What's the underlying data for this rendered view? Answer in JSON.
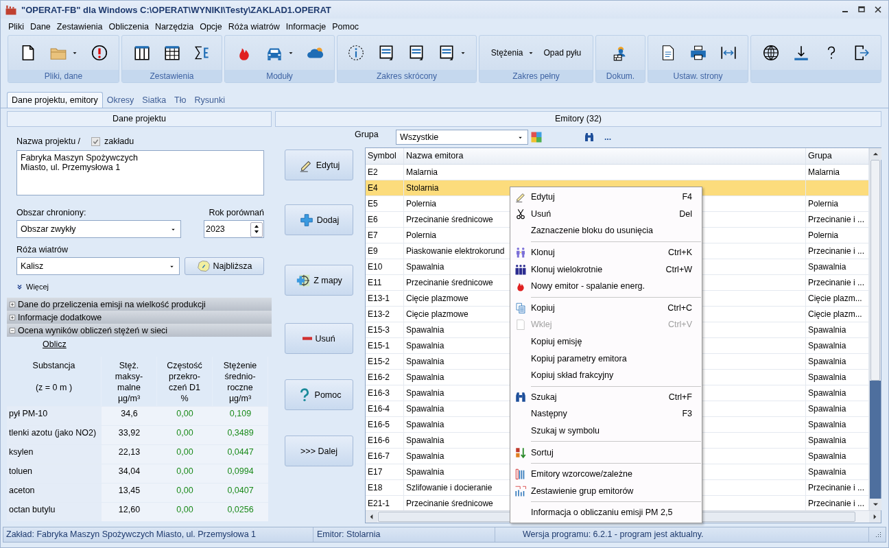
{
  "window": {
    "title": "\"OPERAT-FB\" dla Windows  C:\\OPERAT\\WYNIKI\\Testy\\ZAKLAD1.OPERAT"
  },
  "menu": [
    "Pliki",
    "Dane",
    "Zestawienia",
    "Obliczenia",
    "Narzędzia",
    "Opcje",
    "Róża wiatrów",
    "Informacje",
    "Pomoc"
  ],
  "ribbon": [
    {
      "label": "Pliki, dane",
      "buttons": [
        {
          "kind": "icon",
          "dropdown": false
        },
        {
          "kind": "icon",
          "dropdown": true
        },
        {
          "kind": "icon",
          "dropdown": false
        }
      ]
    },
    {
      "label": "Zestawienia",
      "buttons": [
        {
          "kind": "icon",
          "dropdown": false
        },
        {
          "kind": "icon",
          "dropdown": false
        },
        {
          "kind": "icon",
          "dropdown": false
        }
      ]
    },
    {
      "label": "Moduły",
      "buttons": [
        {
          "kind": "icon",
          "dropdown": false
        },
        {
          "kind": "icon",
          "dropdown": true
        },
        {
          "kind": "icon",
          "dropdown": false
        }
      ]
    },
    {
      "label": "Zakres skrócony",
      "buttons": [
        {
          "kind": "icon",
          "dropdown": false
        },
        {
          "kind": "icon",
          "dropdown": false
        },
        {
          "kind": "icon",
          "dropdown": false
        },
        {
          "kind": "icon",
          "dropdown": true
        }
      ]
    },
    {
      "label": "Zakres pełny",
      "buttons": [
        {
          "kind": "text",
          "label": "Stężenia",
          "dropdown": true
        },
        {
          "kind": "text",
          "label": "Opad pyłu",
          "dropdown": false
        }
      ]
    },
    {
      "label": "Dokum.",
      "buttons": [
        {
          "kind": "icon",
          "dropdown": false
        }
      ]
    },
    {
      "label": "Ustaw. strony",
      "buttons": [
        {
          "kind": "icon",
          "dropdown": false
        },
        {
          "kind": "icon",
          "dropdown": false
        },
        {
          "kind": "icon",
          "dropdown": false
        }
      ]
    },
    {
      "buttons": [
        {
          "kind": "icon",
          "dropdown": false
        },
        {
          "kind": "icon",
          "dropdown": false
        },
        {
          "kind": "icon",
          "dropdown": false
        },
        {
          "kind": "icon",
          "dropdown": false
        }
      ]
    }
  ],
  "tabs": [
    {
      "label": "Dane projektu, emitory",
      "selected": true
    },
    {
      "label": "Okresy",
      "selected": false
    },
    {
      "label": "Siatka",
      "selected": false
    },
    {
      "label": "Tło",
      "selected": false
    },
    {
      "label": "Rysunki",
      "selected": false
    }
  ],
  "project": {
    "title": "Dane projektu",
    "name_label": "Nazwa projektu /",
    "checkbox": {
      "label": "zakładu",
      "checked": true
    },
    "name_value": "Fabryka Maszyn Spożywczych\nMiasto, ul. Przemysłowa 1",
    "area_label": "Obszar chroniony:",
    "area_value": "Obszar zwykły",
    "year_label": "Rok porównań",
    "year_value": "2023",
    "rose_label": "Róża wiatrów",
    "rose_value": "Kalisz",
    "nearest_button": "Najbliższa",
    "more": "Więcej"
  },
  "sections": [
    {
      "label": "Dane do przeliczenia emisji na wielkość produkcji",
      "expanded": false
    },
    {
      "label": "Informacje dodatkowe",
      "expanded": false
    },
    {
      "label": "Ocena wyników obliczeń stężeń w sieci",
      "expanded": true
    }
  ],
  "results": {
    "link": "Oblicz",
    "columns": [
      "Substancja\n\n(z = 0 m )",
      "Stęż.\nmaksy-\nmalne\nµg/m³",
      "Częstość\nprzekro-\nczeń D1\n%",
      "Stężenie\nśrednio-\nroczne\nµg/m³"
    ],
    "rows": [
      {
        "substance": "pył PM-10",
        "max": "34,6",
        "freq": "0,00",
        "avg": "0,109"
      },
      {
        "substance": "tlenki azotu (jako NO2)",
        "max": "33,92",
        "freq": "0,00",
        "avg": "0,3489"
      },
      {
        "substance": "ksylen",
        "max": "22,13",
        "freq": "0,00",
        "avg": "0,0447"
      },
      {
        "substance": "toluen",
        "max": "34,04",
        "freq": "0,00",
        "avg": "0,0994"
      },
      {
        "substance": "aceton",
        "max": "13,45",
        "freq": "0,00",
        "avg": "0,0407"
      },
      {
        "substance": "octan butylu",
        "max": "12,60",
        "freq": "0,00",
        "avg": "0,0256"
      }
    ]
  },
  "actions": [
    "Edytuj",
    "Dodaj",
    "Z mapy",
    "Usuń",
    "Pomoc",
    ">>> Dalej"
  ],
  "emitters": {
    "title": "Emitory (32)",
    "group_label": "Grupa",
    "group_value": "Wszystkie",
    "more": "...",
    "columns": [
      "Symbol",
      "Nazwa emitora",
      "Grupa"
    ],
    "rows": [
      {
        "symbol": "E2",
        "name": "Malarnia",
        "group": "Malarnia",
        "selected": false
      },
      {
        "symbol": "E4",
        "name": "Stolarnia",
        "selected": true
      },
      {
        "symbol": "E5",
        "name": "Polernia",
        "group": "Polernia",
        "selected": false
      },
      {
        "symbol": "E6",
        "name": "Przecinanie średnicowe",
        "group": "Przecinanie i ...",
        "selected": false
      },
      {
        "symbol": "E7",
        "name": "Polernia",
        "group": "Polernia",
        "selected": false
      },
      {
        "symbol": "E9",
        "name": "Piaskowanie elektrokorund",
        "group": "Przecinanie i ...",
        "selected": false
      },
      {
        "symbol": "E10",
        "name": "Spawalnia",
        "group": "Spawalnia",
        "selected": false
      },
      {
        "symbol": "E11",
        "name": "Przecinanie średnicowe",
        "group": "Przecinanie i ...",
        "selected": false
      },
      {
        "symbol": "E13-1",
        "name": "Cięcie plazmowe",
        "group": "Cięcie plazm...",
        "selected": false
      },
      {
        "symbol": "E13-2",
        "name": "Cięcie plazmowe",
        "group": "Cięcie plazm...",
        "selected": false
      },
      {
        "symbol": "E15-3",
        "name": "Spawalnia",
        "group": "Spawalnia",
        "selected": false
      },
      {
        "symbol": "E15-1",
        "name": "Spawalnia",
        "group": "Spawalnia",
        "selected": false
      },
      {
        "symbol": "E15-2",
        "name": "Spawalnia",
        "group": "Spawalnia",
        "selected": false
      },
      {
        "symbol": "E16-2",
        "name": "Spawalnia",
        "group": "Spawalnia",
        "selected": false
      },
      {
        "symbol": "E16-3",
        "name": "Spawalnia",
        "group": "Spawalnia",
        "selected": false
      },
      {
        "symbol": "E16-4",
        "name": "Spawalnia",
        "group": "Spawalnia",
        "selected": false
      },
      {
        "symbol": "E16-5",
        "name": "Spawalnia",
        "group": "Spawalnia",
        "selected": false
      },
      {
        "symbol": "E16-6",
        "name": "Spawalnia",
        "group": "Spawalnia",
        "selected": false
      },
      {
        "symbol": "E16-7",
        "name": "Spawalnia",
        "group": "Spawalnia",
        "selected": false
      },
      {
        "symbol": "E17",
        "name": "Spawalnia",
        "group": "Spawalnia",
        "selected": false
      },
      {
        "symbol": "E18",
        "name": "Szlifowanie i docieranie",
        "group": "Przecinanie i ...",
        "selected": false
      },
      {
        "symbol": "E21-1",
        "name": "Przecinanie średnicowe",
        "group": "Przecinanie i ...",
        "selected": false
      }
    ]
  },
  "context_menu": [
    {
      "kind": "item",
      "label": "Edytuj",
      "shortcut": "F4",
      "disabled": false
    },
    {
      "kind": "item",
      "label": "Usuń",
      "shortcut": "Del",
      "disabled": false
    },
    {
      "kind": "item",
      "label": "Zaznaczenie bloku do usunięcia",
      "disabled": false
    },
    {
      "kind": "separator"
    },
    {
      "kind": "item",
      "label": "Klonuj",
      "shortcut": "Ctrl+K",
      "disabled": false
    },
    {
      "kind": "item",
      "label": "Klonuj wielokrotnie",
      "shortcut": "Ctrl+W",
      "disabled": false
    },
    {
      "kind": "item",
      "label": "Nowy emitor - spalanie energ.",
      "disabled": false
    },
    {
      "kind": "separator"
    },
    {
      "kind": "item",
      "label": "Kopiuj",
      "shortcut": "Ctrl+C",
      "disabled": false
    },
    {
      "kind": "item",
      "label": "Wklej",
      "shortcut": "Ctrl+V",
      "disabled": true
    },
    {
      "kind": "item",
      "label": "Kopiuj emisję",
      "disabled": false
    },
    {
      "kind": "item",
      "label": "Kopiuj parametry emitora",
      "disabled": false
    },
    {
      "kind": "item",
      "label": "Kopiuj skład frakcyjny",
      "disabled": false
    },
    {
      "kind": "separator"
    },
    {
      "kind": "item",
      "label": "Szukaj",
      "shortcut": "Ctrl+F",
      "disabled": false
    },
    {
      "kind": "item",
      "label": "Następny",
      "shortcut": "F3",
      "disabled": false
    },
    {
      "kind": "item",
      "label": "Szukaj w symbolu",
      "disabled": false
    },
    {
      "kind": "separator"
    },
    {
      "kind": "item",
      "label": "Sortuj",
      "disabled": false
    },
    {
      "kind": "separator"
    },
    {
      "kind": "item",
      "label": "Emitory wzorcowe/zależne",
      "disabled": false
    },
    {
      "kind": "item",
      "label": "Zestawienie grup emitorów",
      "disabled": false
    },
    {
      "kind": "separator"
    },
    {
      "kind": "item",
      "label": "Informacja o obliczaniu emisji PM 2,5",
      "disabled": false
    }
  ],
  "status_bar": [
    "Zakład: Fabryka Maszyn Spożywczych  Miasto, ul. Przemysłowa 1",
    "Emitor: Stolarnia",
    "Wersja programu: 6.2.1 - program jest aktualny."
  ]
}
